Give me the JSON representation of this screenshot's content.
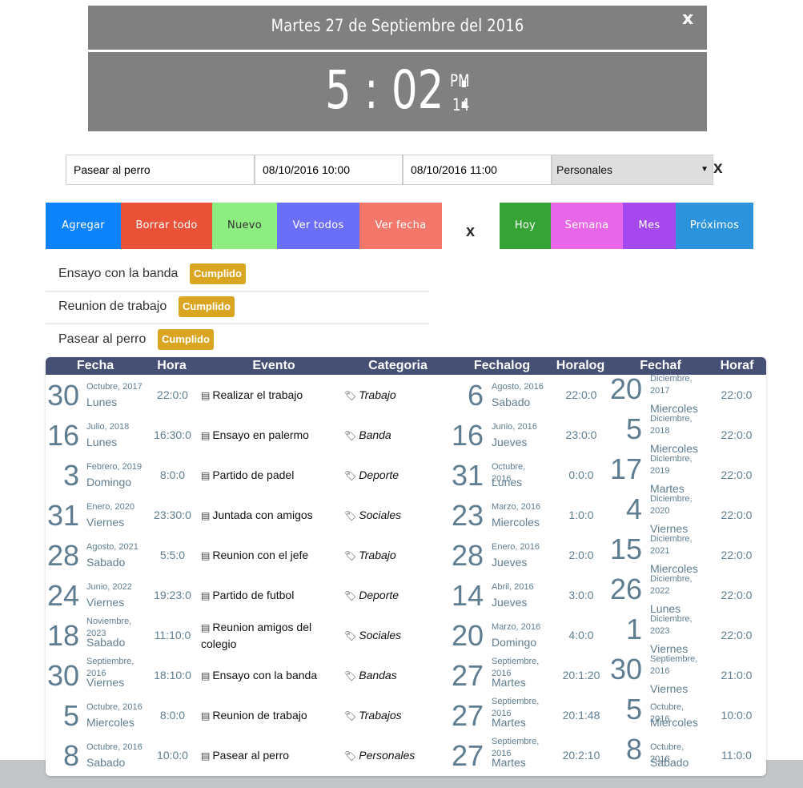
{
  "header": {
    "date": "Martes 27 de Septiembre del 2016",
    "close": "x"
  },
  "clock": {
    "hm": "5 : 02 :",
    "ampm": "PM",
    "seconds": "14"
  },
  "form": {
    "title_value": "Pasear al perro",
    "start_value": "08/10/2016 10:00",
    "end_value": "08/10/2016 11:00",
    "category_value": "Personales",
    "close": "x"
  },
  "buttons": {
    "agregar": "Agregar",
    "borrar": "Borrar todo",
    "nuevo": "Nuevo",
    "ver_todos": "Ver todos",
    "ver_fecha": "Ver fecha",
    "sep": "x",
    "hoy": "Hoy",
    "semana": "Semana",
    "mes": "Mes",
    "proximos": "Próximos"
  },
  "colors": {
    "agregar": "#0d83fb",
    "borrar": "#e95237",
    "nuevo": "#8ded80",
    "ver_todos": "#6b6ef7",
    "ver_fecha": "#f4776b",
    "hoy": "#36a336",
    "semana": "#e867e8",
    "mes": "#a548ee",
    "proximos": "#2b94dd",
    "header_bg": "#808080",
    "table_head": "#455074",
    "badge": "#daa520"
  },
  "reminders": [
    {
      "label": "Ensayo con la banda",
      "badge": "Cumplido"
    },
    {
      "label": "Reunion de trabajo",
      "badge": "Cumplido"
    },
    {
      "label": "Pasear al perro",
      "badge": "Cumplido"
    }
  ],
  "table": {
    "headers": [
      "Fecha",
      "Hora",
      "Evento",
      "Categoria",
      "Fechalog",
      "Horalog",
      "Fechaf",
      "Horaf"
    ],
    "rows": [
      {
        "f_day": "30",
        "f_month": "Octubre, 2017",
        "f_dow": "Lunes",
        "hora": "22:0:0",
        "evento": "Realizar el trabajo",
        "categoria": "Trabajo",
        "l_day": "6",
        "l_month": "Agosto, 2016",
        "l_dow": "Sabado",
        "horalog": "22:0:0",
        "ff_day": "20",
        "ff_month": "Diciembre, 2017",
        "ff_dow": "Miercoles",
        "horaf": "22:0:0"
      },
      {
        "f_day": "16",
        "f_month": "Julio, 2018",
        "f_dow": "Lunes",
        "hora": "16:30:0",
        "evento": "Ensayo en palermo",
        "categoria": "Banda",
        "l_day": "16",
        "l_month": "Junio, 2016",
        "l_dow": "Jueves",
        "horalog": "23:0:0",
        "ff_day": "5",
        "ff_month": "Diciembre, 2018",
        "ff_dow": "Miercoles",
        "horaf": "22:0:0"
      },
      {
        "f_day": "3",
        "f_month": "Febrero, 2019",
        "f_dow": "Domingo",
        "hora": "8:0:0",
        "evento": "Partido de padel",
        "categoria": "Deporte",
        "l_day": "31",
        "l_month": "Octubre, 2016",
        "l_dow": "Lunes",
        "horalog": "0:0:0",
        "ff_day": "17",
        "ff_month": "Diciembre, 2019",
        "ff_dow": "Martes",
        "horaf": "22:0:0"
      },
      {
        "f_day": "31",
        "f_month": "Enero, 2020",
        "f_dow": "Viernes",
        "hora": "23:30:0",
        "evento": "Juntada con amigos",
        "categoria": "Sociales",
        "l_day": "23",
        "l_month": "Marzo, 2016",
        "l_dow": "Miercoles",
        "horalog": "1:0:0",
        "ff_day": "4",
        "ff_month": "Diciembre, 2020",
        "ff_dow": "Viernes",
        "horaf": "22:0:0"
      },
      {
        "f_day": "28",
        "f_month": "Agosto, 2021",
        "f_dow": "Sabado",
        "hora": "5:5:0",
        "evento": "Reunion con el jefe",
        "categoria": "Trabajo",
        "l_day": "28",
        "l_month": "Enero, 2016",
        "l_dow": "Jueves",
        "horalog": "2:0:0",
        "ff_day": "15",
        "ff_month": "Diciembre, 2021",
        "ff_dow": "Miercoles",
        "horaf": "22:0:0"
      },
      {
        "f_day": "24",
        "f_month": "Junio, 2022",
        "f_dow": "Viernes",
        "hora": "19:23:0",
        "evento": "Partido de futbol",
        "categoria": "Deporte",
        "l_day": "14",
        "l_month": "Abril, 2016",
        "l_dow": "Jueves",
        "horalog": "3:0:0",
        "ff_day": "26",
        "ff_month": "Diciembre, 2022",
        "ff_dow": "Lunes",
        "horaf": "22:0:0"
      },
      {
        "f_day": "18",
        "f_month": "Noviembre, 2023",
        "f_dow": "Sabado",
        "hora": "11:10:0",
        "evento": "Reunion amigos del colegio",
        "categoria": "Sociales",
        "l_day": "20",
        "l_month": "Marzo, 2016",
        "l_dow": "Domingo",
        "horalog": "4:0:0",
        "ff_day": "1",
        "ff_month": "Diciembre, 2023",
        "ff_dow": "Viernes",
        "horaf": "22:0:0"
      },
      {
        "f_day": "30",
        "f_month": "Septiembre, 2016",
        "f_dow": "Viernes",
        "hora": "18:10:0",
        "evento": "Ensayo con la banda",
        "categoria": "Bandas",
        "l_day": "27",
        "l_month": "Septiembre, 2016",
        "l_dow": "Martes",
        "horalog": "20:1:20",
        "ff_day": "30",
        "ff_month": "Septiembre, 2016",
        "ff_dow": "Viernes",
        "horaf": "21:0:0"
      },
      {
        "f_day": "5",
        "f_month": "Octubre, 2016",
        "f_dow": "Miercoles",
        "hora": "8:0:0",
        "evento": "Reunion de trabajo",
        "categoria": "Trabajos",
        "l_day": "27",
        "l_month": "Septiembre, 2016",
        "l_dow": "Martes",
        "horalog": "20:1:48",
        "ff_day": "5",
        "ff_month": "Octubre, 2016",
        "ff_dow": "Miercoles",
        "horaf": "10:0:0"
      },
      {
        "f_day": "8",
        "f_month": "Octubre, 2016",
        "f_dow": "Sabado",
        "hora": "10:0:0",
        "evento": "Pasear al perro",
        "categoria": "Personales",
        "l_day": "27",
        "l_month": "Septiembre, 2016",
        "l_dow": "Martes",
        "horalog": "20:2:10",
        "ff_day": "8",
        "ff_month": "Octubre, 2016",
        "ff_dow": "Sabado",
        "horaf": "11:0:0"
      }
    ]
  }
}
